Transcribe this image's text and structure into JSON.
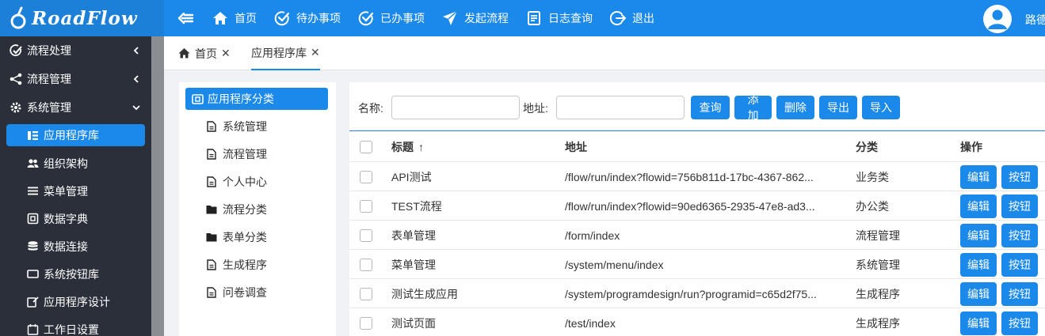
{
  "app": {
    "logo": "RoadFlow",
    "user": "路德"
  },
  "topnav": [
    {
      "label": "首页",
      "icon": "home-icon"
    },
    {
      "label": "待办事项",
      "icon": "check-circle-icon"
    },
    {
      "label": "已办事项",
      "icon": "check-circle-icon"
    },
    {
      "label": "发起流程",
      "icon": "send-icon"
    },
    {
      "label": "日志查询",
      "icon": "log-icon"
    },
    {
      "label": "退出",
      "icon": "logout-icon"
    }
  ],
  "sidebar": {
    "groups": [
      {
        "label": "流程处理"
      },
      {
        "label": "流程管理"
      },
      {
        "label": "系统管理"
      }
    ],
    "items": [
      {
        "label": "应用程序库"
      },
      {
        "label": "组织架构"
      },
      {
        "label": "菜单管理"
      },
      {
        "label": "数据字典"
      },
      {
        "label": "数据连接"
      },
      {
        "label": "系统按钮库"
      },
      {
        "label": "应用程序设计"
      },
      {
        "label": "工作日设置"
      }
    ]
  },
  "tabs": [
    {
      "label": "首页"
    },
    {
      "label": "应用程序库"
    }
  ],
  "tree": {
    "root": "应用程序分类",
    "nodes": [
      {
        "label": "系统管理",
        "icon": "file-icon"
      },
      {
        "label": "流程管理",
        "icon": "file-icon"
      },
      {
        "label": "个人中心",
        "icon": "file-icon"
      },
      {
        "label": "流程分类",
        "icon": "folder-icon"
      },
      {
        "label": "表单分类",
        "icon": "folder-icon"
      },
      {
        "label": "生成程序",
        "icon": "file-icon"
      },
      {
        "label": "问卷调查",
        "icon": "file-icon"
      }
    ]
  },
  "search": {
    "name_label": "名称:",
    "name_value": "",
    "address_label": "地址:",
    "address_value": "",
    "buttons": {
      "query": "查询",
      "add": "添加",
      "delete": "删除",
      "export": "导出",
      "import": "导入"
    }
  },
  "table": {
    "columns": {
      "title": "标题",
      "sort_arrow": "↑",
      "address": "地址",
      "category": "分类",
      "actions": "操作"
    },
    "edit_label": "编辑",
    "button_label": "按钮",
    "rows": [
      {
        "title": "API测试",
        "address": "/flow/run/index?flowid=756b811d-17bc-4367-862...",
        "category": "业务类"
      },
      {
        "title": "TEST流程",
        "address": "/flow/run/index?flowid=90ed6365-2935-47e8-ad3...",
        "category": "办公类"
      },
      {
        "title": "表单管理",
        "address": "/form/index",
        "category": "流程管理"
      },
      {
        "title": "菜单管理",
        "address": "/system/menu/index",
        "category": "系统管理"
      },
      {
        "title": "测试生成应用",
        "address": "/system/programdesign/run?programid=c65d2f75...",
        "category": "生成程序"
      },
      {
        "title": "测试页面",
        "address": "/test/index",
        "category": "生成程序"
      }
    ]
  }
}
